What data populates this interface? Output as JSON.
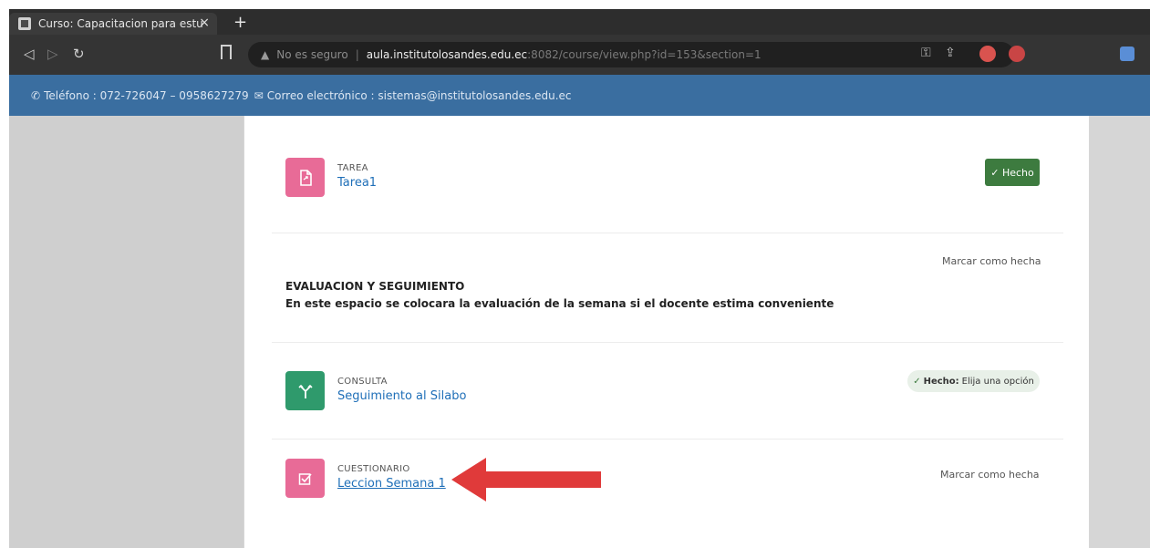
{
  "browser": {
    "tab_title": "Curso: Capacitacion para estudia",
    "tab_close": "×",
    "new_tab": "+",
    "not_secure": "No es seguro",
    "url_sep": "|",
    "url_host": "aula.institutolosandes.edu.ec",
    "url_path": ":8082/course/view.php?id=153&section=1"
  },
  "infobar": {
    "phone_icon": "phone-icon",
    "phone": "Teléfono : 072-726047 – 0958627279",
    "mail_icon": "mail-icon",
    "email": "Correo electrónico : sistemas@institutolosandes.edu.ec"
  },
  "activities": [
    {
      "type": "TAREA",
      "name": "Tarea1",
      "icon": "assignment-icon",
      "color": "#e86b97",
      "status": "Hecho"
    },
    {
      "type": "CONSULTA",
      "name": "Seguimiento al Silabo",
      "icon": "choice-icon",
      "color": "#2f9a6c",
      "status_bold": "Hecho:",
      "status_rest": "Elija una opción"
    },
    {
      "type": "CUESTIONARIO",
      "name": "Leccion Semana 1",
      "icon": "quiz-icon",
      "color": "#e86b97",
      "status": "Marcar como hecha"
    }
  ],
  "section": {
    "mark_done": "Marcar como hecha",
    "title": "EVALUACION Y SEGUIMIENTO",
    "description": "En este espacio se colocara la evaluación de la semana si el docente estima conveniente"
  },
  "colors": {
    "infobar": "#3a6ea0",
    "done_button": "#3d7b3f",
    "link": "#1f6fb8",
    "annotation_arrow": "#e03a3a"
  }
}
